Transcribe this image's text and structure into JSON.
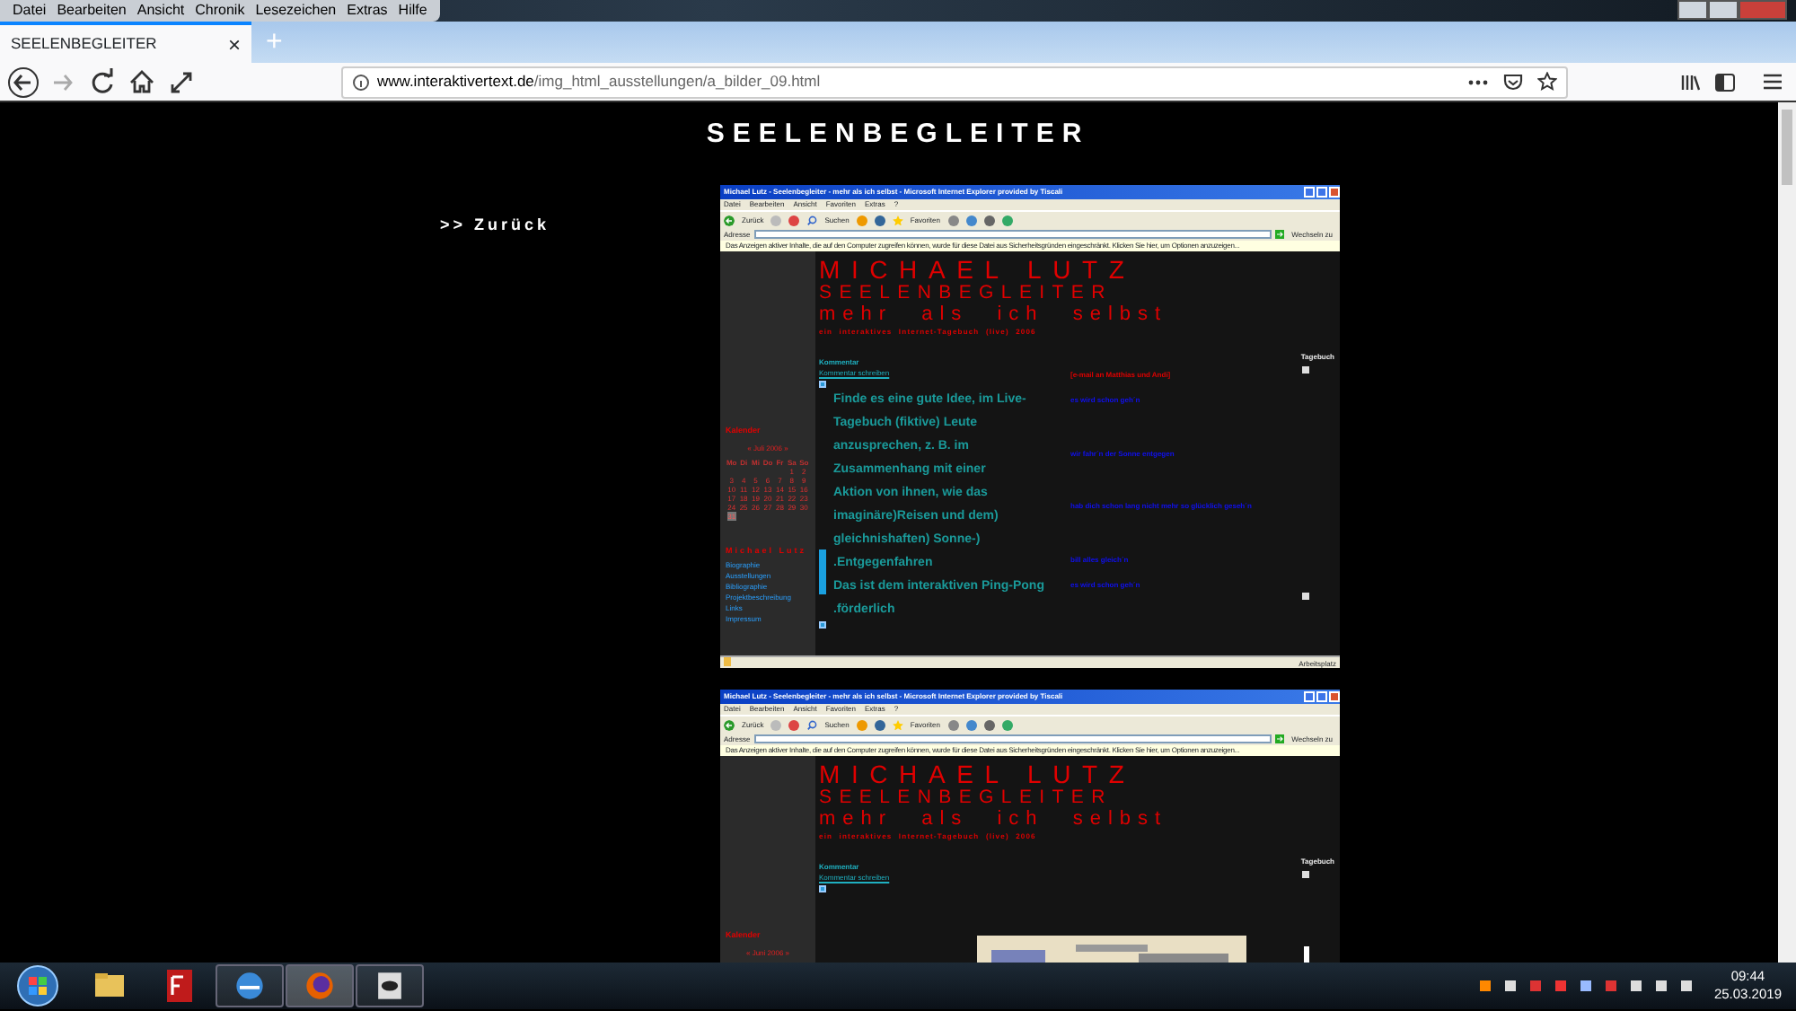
{
  "menu": [
    "Datei",
    "Bearbeiten",
    "Ansicht",
    "Chronik",
    "Lesezeichen",
    "Extras",
    "Hilfe"
  ],
  "tab": {
    "title": "SEELENBEGLEITER",
    "close": "×",
    "new_tab": "+",
    "selected": true
  },
  "address": {
    "host": "www.interaktivertext.de",
    "path": "/img_html_ausstellungen/a_bilder_09.html"
  },
  "page": {
    "title": "SEELENBEGLEITER",
    "back_link": ">> Zurück"
  },
  "screenshots": [
    {
      "kind": "poem",
      "window_title": "Michael Lutz - Seelenbegleiter - mehr als ich selbst - Microsoft Internet Explorer provided by Tiscali",
      "menu": [
        "Datei",
        "Bearbeiten",
        "Ansicht",
        "Favoriten",
        "Extras",
        "?"
      ],
      "toolbar": [
        "Zurück",
        "Suchen",
        "Favoriten"
      ],
      "address_label": "Adresse",
      "go": "Wechseln zu",
      "info_bar": "Das Anzeigen aktiver Inhalte, die auf den Computer zugreifen können, wurde für diese Datei aus Sicherheitsgründen eingeschränkt. Klicken Sie hier, um Optionen anzuzeigen...",
      "header": [
        "MICHAEL LUTZ",
        "SEELENBEGLEITER",
        "mehr als ich selbst",
        "ein interaktives Internet-Tagebuch (live) 2006"
      ],
      "comment": "Kommentar",
      "comment_link": "Kommentar schreiben",
      "diary": "Tagebuch",
      "calendar": {
        "title": "Kalender",
        "month": "« Juli 2006 »",
        "weekdays": [
          "Mo",
          "Di",
          "Mi",
          "Do",
          "Fr",
          "Sa",
          "So"
        ],
        "weeks": [
          [
            {
              "d": "1",
              "selected": false
            },
            {
              "d": "2",
              "selected": false
            }
          ],
          [
            {
              "d": "3",
              "selected": false
            },
            {
              "d": "4",
              "selected": false
            },
            {
              "d": "5",
              "selected": false
            },
            {
              "d": "6",
              "selected": false
            },
            {
              "d": "7",
              "selected": false
            },
            {
              "d": "8",
              "selected": false
            },
            {
              "d": "9",
              "selected": false
            }
          ],
          [
            {
              "d": "10",
              "selected": false
            },
            {
              "d": "11",
              "selected": false
            },
            {
              "d": "12",
              "selected": false
            },
            {
              "d": "13",
              "selected": false
            },
            {
              "d": "14",
              "selected": false
            },
            {
              "d": "15",
              "selected": false
            },
            {
              "d": "16",
              "selected": false
            }
          ],
          [
            {
              "d": "17",
              "selected": false
            },
            {
              "d": "18",
              "selected": false
            },
            {
              "d": "19",
              "selected": false
            },
            {
              "d": "20",
              "selected": false
            },
            {
              "d": "21",
              "selected": false
            },
            {
              "d": "22",
              "selected": false
            },
            {
              "d": "23",
              "selected": false
            }
          ],
          [
            {
              "d": "24",
              "selected": false
            },
            {
              "d": "25",
              "selected": false
            },
            {
              "d": "26",
              "selected": false
            },
            {
              "d": "27",
              "selected": false
            },
            {
              "d": "28",
              "selected": false
            },
            {
              "d": "29",
              "selected": false
            },
            {
              "d": "30",
              "selected": false
            }
          ],
          [
            {
              "d": "31",
              "selected": true
            }
          ]
        ]
      },
      "author": "Michael Lutz",
      "nav_links": [
        "Biographie",
        "Ausstellungen",
        "Bibliographie",
        "Projektbeschreibung",
        "Links",
        "Impressum"
      ],
      "poem": [
        "Finde es eine gute Idee, im Live-",
        "Tagebuch (fiktive) Leute",
        "anzusprechen, z. B. im",
        "Zusammenhang mit einer",
        "Aktion von ihnen, wie das",
        "imaginäre)Reisen und dem)",
        "gleichnishaften) Sonne-)",
        ".Entgegenfahren",
        "Das ist dem interaktiven Ping-Pong",
        ".förderlich"
      ],
      "entries": [
        {
          "text": "[e-mail an Matthias und Andi]",
          "color": "#e00000"
        },
        {
          "text": "es wird schon geh´n",
          "color": "#1010f0"
        },
        {
          "text": "wir fahr´n der Sonne entgegen",
          "color": "#1010f0"
        },
        {
          "text": "hab dich schon lang nicht mehr so glücklich geseh´n",
          "color": "#1010f0"
        },
        {
          "text": "bill alles gleich´n",
          "color": "#1010f0"
        },
        {
          "text": "es wird schon geh´n",
          "color": "#1010f0"
        }
      ],
      "status": "Arbeitsplatz"
    },
    {
      "window_title": "Michael Lutz - Seelenbegleiter - mehr als ich selbst - Microsoft Internet Explorer provided by Tiscali",
      "menu": [
        "Datei",
        "Bearbeiten",
        "Ansicht",
        "Favoriten",
        "Extras",
        "?"
      ],
      "toolbar": [
        "Zurück",
        "Suchen",
        "Favoriten"
      ],
      "address_label": "Adresse",
      "go": "Wechseln zu",
      "info_bar": "Das Anzeigen aktiver Inhalte, die auf den Computer zugreifen können, wurde für diese Datei aus Sicherheitsgründen eingeschränkt. Klicken Sie hier, um Optionen anzuzeigen...",
      "header": [
        "MICHAEL LUTZ",
        "SEELENBEGLEITER",
        "mehr als ich selbst",
        "ein interaktives Internet-Tagebuch (live) 2006"
      ],
      "comment": "Kommentar",
      "comment_link": "Kommentar schreiben",
      "diary": "Tagebuch",
      "calendar": {
        "title": "Kalender",
        "month": "« Juni 2006 »"
      }
    }
  ],
  "clock": {
    "time": "09:44",
    "date": "25.03.2019"
  }
}
